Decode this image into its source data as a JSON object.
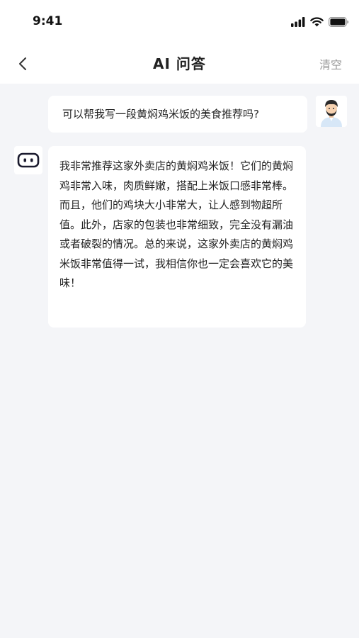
{
  "status_bar": {
    "time": "9:41"
  },
  "header": {
    "title": "AI 问答",
    "clear_label": "清空"
  },
  "messages": {
    "user": {
      "text": "可以帮我写一段黄焖鸡米饭的美食推荐吗?"
    },
    "bot": {
      "text": "我非常推荐这家外卖店的黄焖鸡米饭！它们的黄焖鸡非常入味，肉质鲜嫩，搭配上米饭口感非常棒。而且，他们的鸡块大小非常大，让人感到物超所值。此外，店家的包装也非常细致，完全没有漏油或者破裂的情况。总的来说，这家外卖店的黄焖鸡米饭非常值得一试，我相信你也一定会喜欢它的美味！"
    }
  },
  "icons": {
    "back": "chevron-left-icon",
    "signal": "signal-icon",
    "wifi": "wifi-icon",
    "battery": "battery-icon",
    "user_avatar": "user-avatar",
    "bot_avatar": "robot-icon"
  },
  "colors": {
    "background": "#f4f5f8",
    "bubble": "#ffffff",
    "muted_text": "#9a9a9a"
  }
}
